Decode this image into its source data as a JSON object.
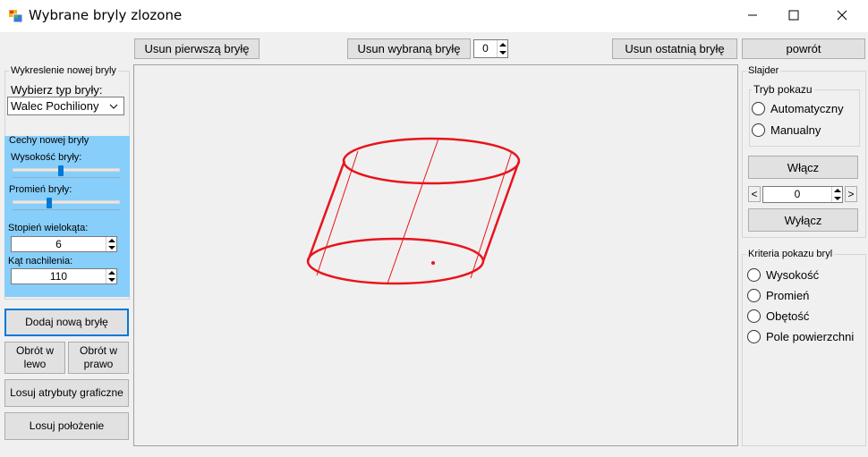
{
  "window": {
    "title": "Wybrane bryly zlozone",
    "icon": "windows-forms-icon",
    "controls": {
      "minimize": "minimize-icon",
      "maximize": "maximize-icon",
      "close": "close-icon"
    }
  },
  "toolbar": {
    "remove_first": "Usun pierwszą bryłę",
    "remove_selected": "Usun wybraną bryłę",
    "selected_index": "0",
    "remove_last": "Usun ostatnią bryłę",
    "back": "powrót"
  },
  "left_panel": {
    "group_title": "Wykreslenie nowej bryly",
    "choose_type_label": "Wybierz typ bryły:",
    "type_value": "Walec Pochiliony",
    "features_title": "Cechy nowej bryly",
    "height_label": "Wysokość bryły:",
    "height_slider_level": 0.45,
    "radius_label": "Promień bryły:",
    "radius_slider_level": 0.33,
    "polygon_degree_label": "Stopień wielokąta:",
    "polygon_degree_value": "6",
    "tilt_label": "Kąt nachilenia:",
    "tilt_value": "110",
    "add_button": "Dodaj nową bryłę",
    "rotate_left": "Obrót w lewo",
    "rotate_right": "Obrót w prawo",
    "random_graphics": "Losuj atrybuty graficzne",
    "random_position": "Losuj położenie",
    "features_bg": "#87cefa"
  },
  "slider_panel": {
    "group_title": "Slajder",
    "mode_title": "Tryb pokazu",
    "mode_auto": "Automatyczny",
    "mode_manual": "Manualny",
    "on_button": "Włącz",
    "prev": "<",
    "counter": "0",
    "next": ">",
    "off_button": "Wyłącz"
  },
  "criteria_panel": {
    "group_title": "Kriteria pokazu bryl",
    "options": [
      "Wysokość",
      "Promień",
      "Obętość",
      "Pole powierzchni"
    ]
  },
  "drawing": {
    "stroke_color": "#e8141c",
    "shape": "oblique-cylinder"
  }
}
